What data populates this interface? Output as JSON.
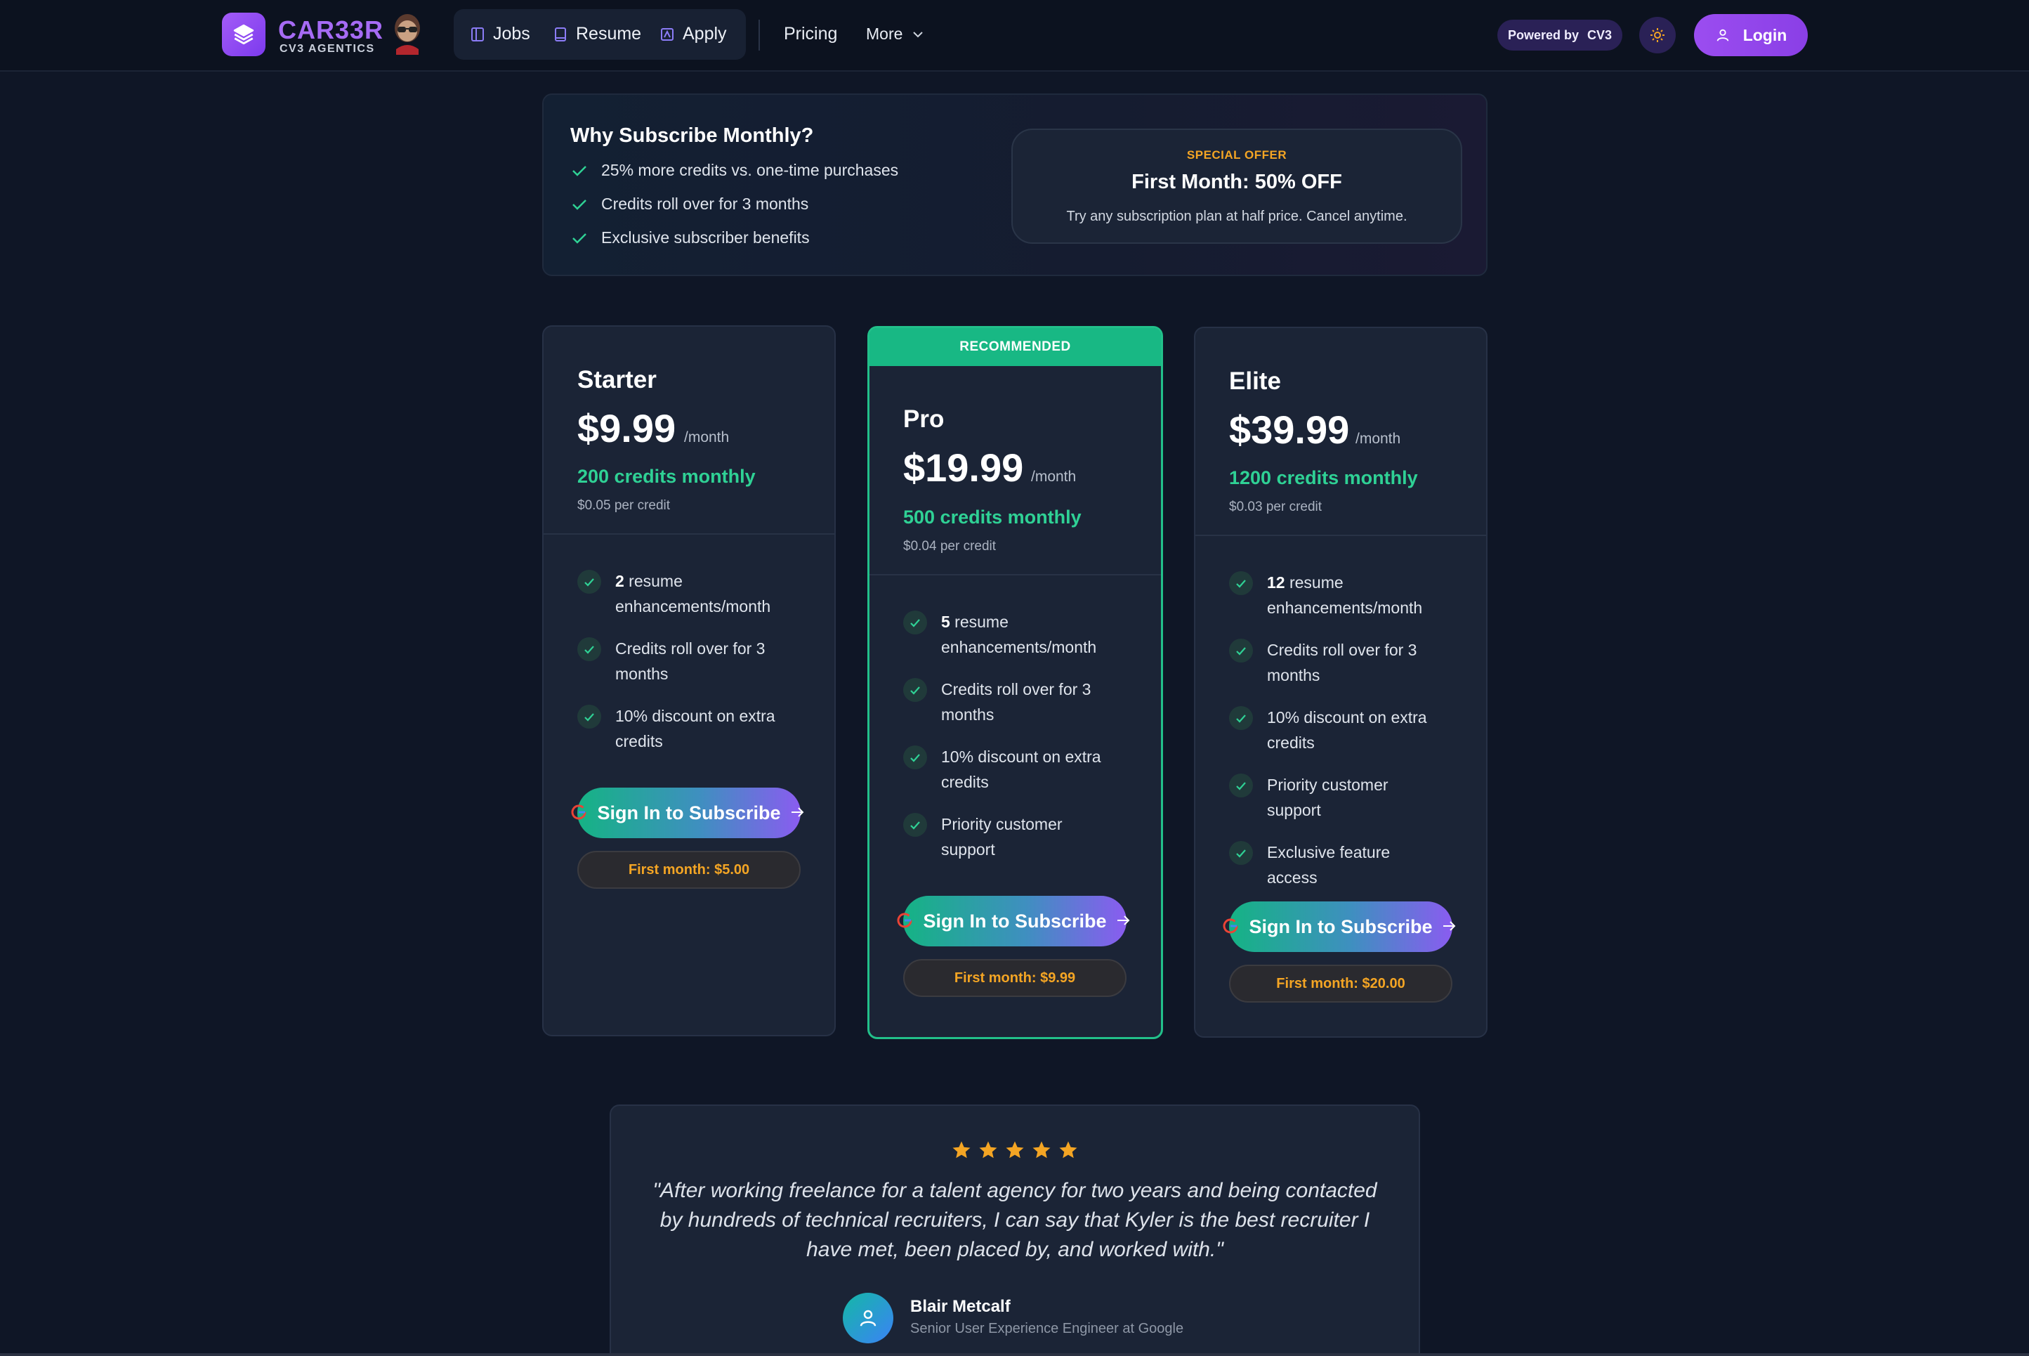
{
  "nav": {
    "brand": "CAR33R",
    "brand_sub": "CV3 AGENTICS",
    "links": [
      {
        "label": "Jobs",
        "icon": "board-icon"
      },
      {
        "label": "Resume",
        "icon": "document-icon"
      },
      {
        "label": "Apply",
        "icon": "apply-icon"
      }
    ],
    "pricing": "Pricing",
    "more": "More",
    "powered_by": "Powered by",
    "powered_brand": "CV3",
    "login": "Login"
  },
  "why": {
    "title": "Why Subscribe Monthly?",
    "items": [
      "25% more credits vs. one-time purchases",
      "Credits roll over for 3 months",
      "Exclusive subscriber benefits"
    ],
    "offer_tag": "SPECIAL OFFER",
    "offer_title": "First Month: 50% OFF",
    "offer_desc": "Try any subscription plan at half price. Cancel anytime."
  },
  "plans": [
    {
      "name": "Starter",
      "price": "$9.99",
      "per": "/month",
      "credits": "200 credits monthly",
      "cpc": "$0.05 per credit",
      "features": [
        {
          "bold": "2",
          "text": " resume enhancements/month"
        },
        {
          "bold": "",
          "text": "Credits roll over for 3 months"
        },
        {
          "bold": "",
          "text": "10% discount on extra credits"
        }
      ],
      "cta": "Sign In to Subscribe",
      "first_month_label": "First month:",
      "first_month_price": "$5.00"
    },
    {
      "name": "Pro",
      "price": "$19.99",
      "per": "/month",
      "badge": "RECOMMENDED",
      "credits": "500 credits monthly",
      "cpc": "$0.04 per credit",
      "features": [
        {
          "bold": "5",
          "text": " resume enhancements/month"
        },
        {
          "bold": "",
          "text": "Credits roll over for 3 months"
        },
        {
          "bold": "",
          "text": "10% discount on extra credits"
        },
        {
          "bold": "",
          "text": "Priority customer support"
        }
      ],
      "cta": "Sign In to Subscribe",
      "first_month_label": "First month:",
      "first_month_price": "$9.99"
    },
    {
      "name": "Elite",
      "price": "$39.99",
      "per": "/month",
      "credits": "1200 credits monthly",
      "cpc": "$0.03 per credit",
      "features": [
        {
          "bold": "12",
          "text": " resume enhancements/month"
        },
        {
          "bold": "",
          "text": "Credits roll over for 3 months"
        },
        {
          "bold": "",
          "text": "10% discount on extra credits"
        },
        {
          "bold": "",
          "text": "Priority customer support"
        },
        {
          "bold": "",
          "text": "Exclusive feature access"
        }
      ],
      "cta": "Sign In to Subscribe",
      "first_month_label": "First month:",
      "first_month_price": "$20.00"
    }
  ],
  "testimonial": {
    "rating": 5,
    "quote": "\"After working freelance for a talent agency for two years and being contacted by hundreds of technical recruiters, I can say that Kyler is the best recruiter I have met, been placed by, and worked with.\"",
    "name": "Blair Metcalf",
    "role": "Senior User Experience Engineer at Google"
  },
  "colors": {
    "accent_purple": "#9b4df0",
    "accent_green": "#22c08a",
    "offer_orange": "#f4a524",
    "background": "#0f1626"
  }
}
